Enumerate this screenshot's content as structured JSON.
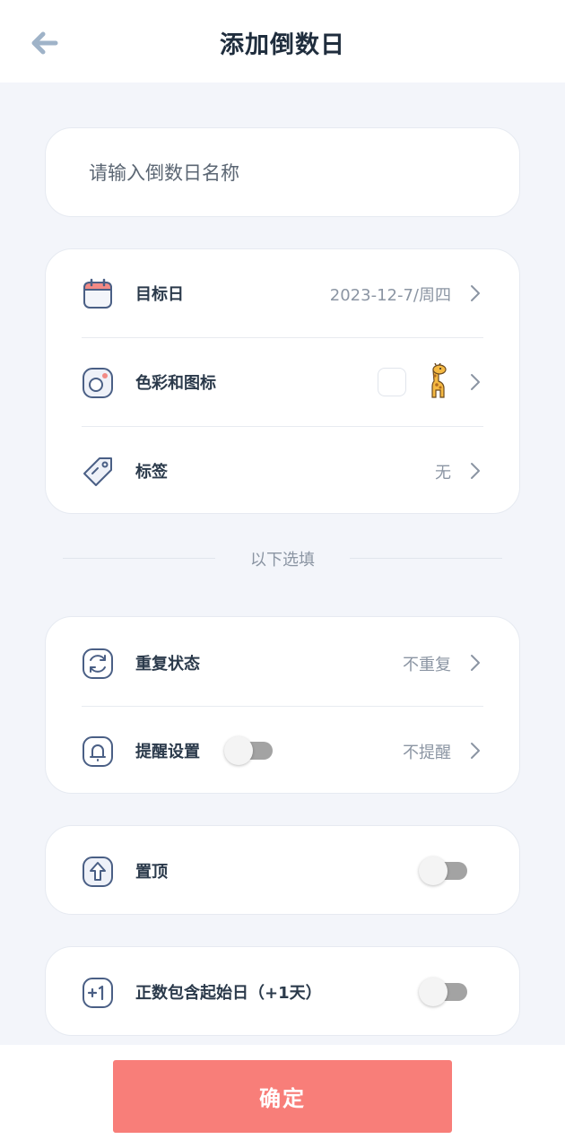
{
  "header": {
    "title": "添加倒数日"
  },
  "name_input": {
    "placeholder": "请输入倒数日名称",
    "value": ""
  },
  "main_card": {
    "target_date": {
      "label": "目标日",
      "value": "2023-12-7/周四"
    },
    "color_icon": {
      "label": "色彩和图标",
      "icon_name": "giraffe-icon",
      "swatch_color": "#ffffff"
    },
    "tag": {
      "label": "标签",
      "value": "无"
    }
  },
  "optional_caption": "以下选填",
  "repeat_card": {
    "repeat": {
      "label": "重复状态",
      "value": "不重复"
    },
    "reminder": {
      "label": "提醒设置",
      "value": "不提醒",
      "toggle_on": false
    }
  },
  "pin": {
    "label": "置顶",
    "toggle_on": false
  },
  "include_start": {
    "label": "正数包含起始日（+1天）",
    "icon_text": "+1",
    "toggle_on": false
  },
  "confirm_label": "确定",
  "colors": {
    "accent": "#f87e79",
    "icon_blue": "#4a5f85",
    "back_arrow": "#9fb3c8"
  }
}
